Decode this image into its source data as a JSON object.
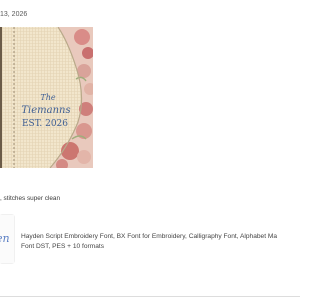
{
  "review": {
    "date": "13, 2026",
    "photo_text": {
      "line1": "The",
      "line2": "Tiemanns",
      "line3": "EST. 2026"
    },
    "text": ", stitches super clean"
  },
  "product": {
    "title_line1": "Hayden Script Embroidery Font, BX Font for Embroidery, Calligraphy Font, Alphabet Ma",
    "title_line2": "Font DST, PES + 10 formats",
    "thumb_text": "en"
  },
  "colors": {
    "linen": "#f1e4c8",
    "floral_pink": "#d99a92",
    "stitch_blue": "#3f5f94",
    "thumb_blue": "#5b7fc4"
  }
}
